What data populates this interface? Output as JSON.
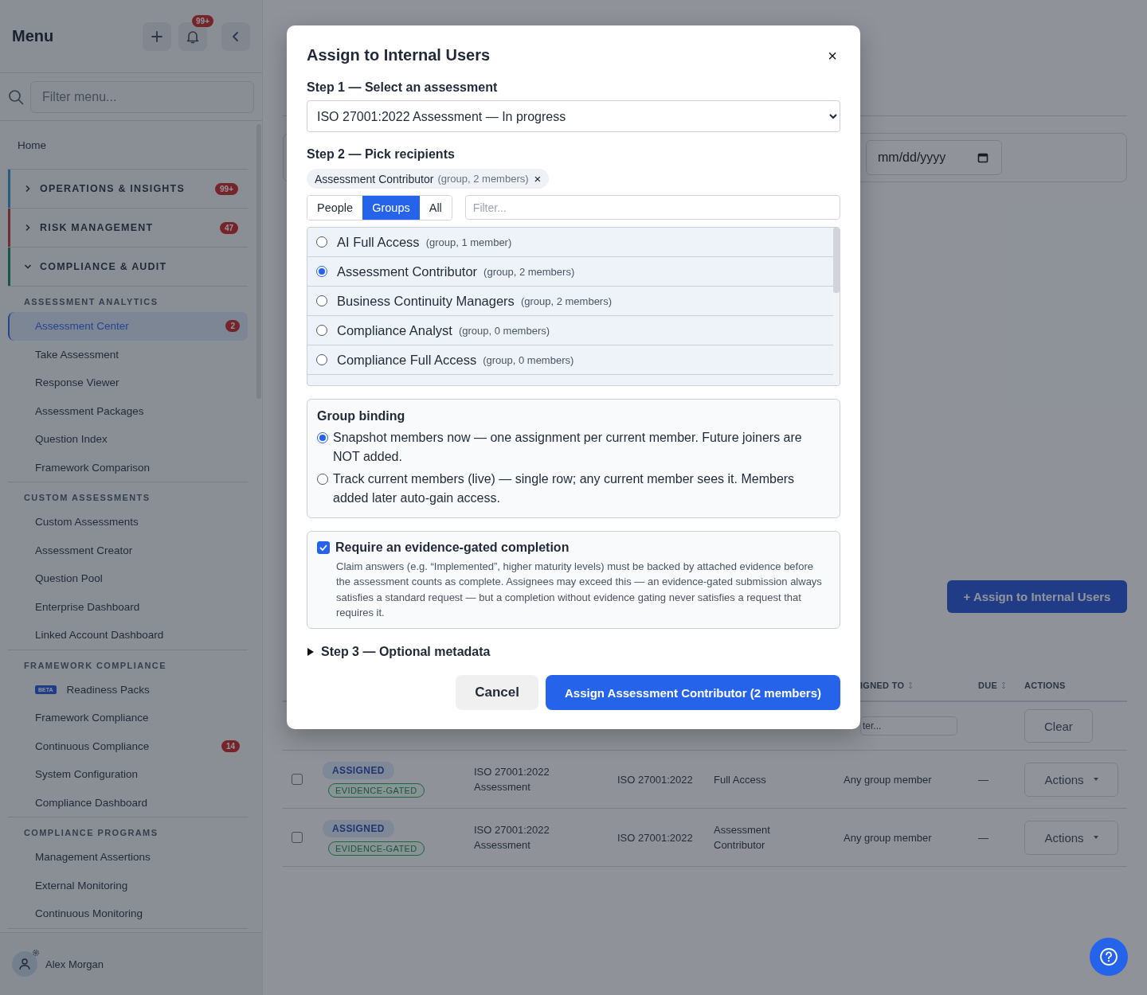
{
  "sidebar": {
    "title": "Menu",
    "notification_count": "99+",
    "search": {
      "placeholder": "Filter menu..."
    },
    "home": "Home",
    "sections": [
      {
        "label": "OPERATIONS & INSIGHTS",
        "badge": "99+",
        "expanded": false,
        "color": "#285c7f"
      },
      {
        "label": "RISK MANAGEMENT",
        "badge": "47",
        "expanded": false,
        "color": "#712d30"
      },
      {
        "label": "COMPLIANCE & AUDIT",
        "expanded": true,
        "color": "#1b5440",
        "groups": [
          {
            "heading": "ASSESSMENT ANALYTICS",
            "items": [
              {
                "label": "Assessment Center",
                "selected": true,
                "badge": "2"
              },
              {
                "label": "Take Assessment",
                "selected": false
              },
              {
                "label": "Response Viewer",
                "selected": false
              },
              {
                "label": "Assessment Packages",
                "selected": false
              },
              {
                "label": "Question Index",
                "selected": false
              },
              {
                "label": "Framework Comparison",
                "selected": false
              }
            ]
          },
          {
            "heading": "CUSTOM ASSESSMENTS",
            "items": [
              {
                "label": "Custom Assessments",
                "selected": false
              },
              {
                "label": "Assessment Creator",
                "selected": false
              },
              {
                "label": "Question Pool",
                "selected": false
              },
              {
                "label": "Enterprise Dashboard",
                "selected": false
              },
              {
                "label": "Linked Account Dashboard",
                "selected": false
              }
            ]
          },
          {
            "heading": "FRAMEWORK COMPLIANCE",
            "items": [
              {
                "label": "Readiness Packs",
                "selected": false,
                "tag": "BETA"
              },
              {
                "label": "Framework Compliance",
                "selected": false
              },
              {
                "label": "Continuous Compliance",
                "selected": false,
                "badge": "14"
              },
              {
                "label": "System Configuration",
                "selected": false
              },
              {
                "label": "Compliance Dashboard",
                "selected": false
              }
            ]
          },
          {
            "heading": "COMPLIANCE PROGRAMS",
            "items": [
              {
                "label": "Management Assertions",
                "selected": false
              },
              {
                "label": "External Monitoring",
                "selected": false
              },
              {
                "label": "Continuous Monitoring",
                "selected": false
              }
            ]
          }
        ]
      }
    ],
    "user": {
      "name": "Alex Morgan"
    }
  },
  "main": {
    "date_field": {
      "placeholder": "mm/dd/yyyy"
    },
    "assign_button": "+ Assign to Internal Users",
    "table": {
      "columns": [
        {
          "label": "IGNED TO",
          "sortable": true
        },
        {
          "label": "DUE",
          "sortable": true
        },
        {
          "label": "ACTIONS",
          "sortable": false
        }
      ],
      "filter_placeholder": "ter...",
      "clear_button": "Clear",
      "rows": [
        {
          "checked": false,
          "status": "ASSIGNED",
          "tag": "EVIDENCE-GATED",
          "assessment": "ISO 27001:2022 Assessment",
          "framework": "ISO 27001:2022",
          "group": "Full Access",
          "assigned_to": "Any group member",
          "due": "—",
          "action": "Actions"
        },
        {
          "checked": false,
          "status": "ASSIGNED",
          "tag": "EVIDENCE-GATED",
          "assessment": "ISO 27001:2022 Assessment",
          "framework": "ISO 27001:2022",
          "group": "Assessment Contributor",
          "assigned_to": "Any group member",
          "due": "—",
          "action": "Actions"
        }
      ]
    }
  },
  "modal": {
    "title": "Assign to Internal Users",
    "close": "×",
    "step1": {
      "label": "Step 1 — Select an assessment",
      "value": "ISO 27001:2022 Assessment — In progress"
    },
    "step2": {
      "label": "Step 2 — Pick recipients",
      "chips": [
        {
          "name": "Assessment Contributor",
          "meta": "(group, 2 members)",
          "remove": "×"
        }
      ],
      "tabs": [
        {
          "label": "People",
          "selected": false
        },
        {
          "label": "Groups",
          "selected": true
        },
        {
          "label": "All",
          "selected": false
        }
      ],
      "filter": {
        "placeholder": "Filter..."
      },
      "options": [
        {
          "name": "AI Full Access",
          "meta": "(group, 1 member)",
          "selected": false
        },
        {
          "name": "Assessment Contributor",
          "meta": "(group, 2 members)",
          "selected": true
        },
        {
          "name": "Business Continuity Managers",
          "meta": "(group, 2 members)",
          "selected": false
        },
        {
          "name": "Compliance Analyst",
          "meta": "(group, 0 members)",
          "selected": false
        },
        {
          "name": "Compliance Full Access",
          "meta": "(group, 0 members)",
          "selected": false
        }
      ]
    },
    "binding": {
      "heading": "Group binding",
      "options": [
        {
          "text": "Snapshot members now — one assignment per current member. Future joiners are NOT added.",
          "selected": true
        },
        {
          "text": "Track current members (live) — single row; any current member sees it. Members added later auto-gain access.",
          "selected": false
        }
      ]
    },
    "evidence": {
      "checked": true,
      "label": "Require an evidence-gated completion",
      "description": "Claim answers (e.g. “Implemented”, higher maturity levels) must be backed by attached evidence before the assessment counts as complete. Assignees may exceed this — an evidence-gated submission always satisfies a standard request — but a completion without evidence gating never satisfies a request that requires it."
    },
    "step3": {
      "label": "Step 3 — Optional metadata",
      "expanded": false
    },
    "buttons": [
      {
        "label": "Cancel",
        "kind": "secondary"
      },
      {
        "label": "Assign Assessment Contributor (2 members)",
        "kind": "primary"
      }
    ]
  }
}
